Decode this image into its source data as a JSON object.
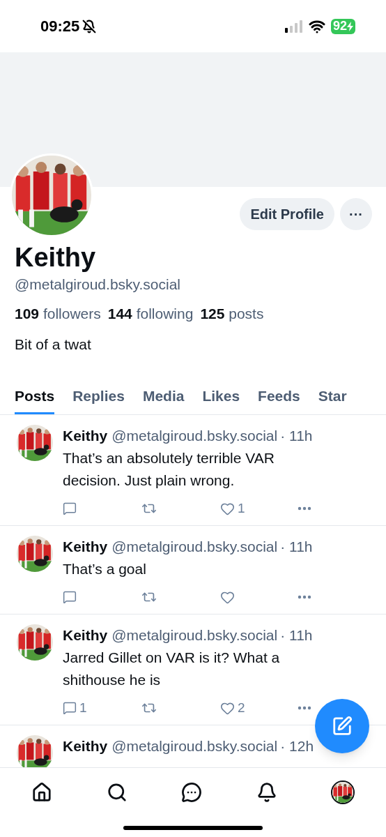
{
  "status_bar": {
    "time": "09:25",
    "battery": "92"
  },
  "profile": {
    "name": "Keithy",
    "handle": "@metalgiroud.bsky.social",
    "edit_button": "Edit Profile",
    "more_button": "···",
    "stats": [
      {
        "count": "109",
        "label": "followers"
      },
      {
        "count": "144",
        "label": "following"
      },
      {
        "count": "125",
        "label": "posts"
      }
    ],
    "bio": "Bit of a twat"
  },
  "tabs": [
    {
      "label": "Posts",
      "selected": true
    },
    {
      "label": "Replies",
      "selected": false
    },
    {
      "label": "Media",
      "selected": false
    },
    {
      "label": "Likes",
      "selected": false
    },
    {
      "label": "Feeds",
      "selected": false
    },
    {
      "label": "Star",
      "selected": false
    }
  ],
  "posts": [
    {
      "name": "Keithy",
      "handle": "@metalgiroud.bsky.social",
      "time": "· 11h",
      "text": "That’s an absolutely terrible VAR decision. Just plain wrong.",
      "likes": "1"
    },
    {
      "name": "Keithy",
      "handle": "@metalgiroud.bsky.social",
      "time": "· 11h",
      "text": "That’s a goal"
    },
    {
      "name": "Keithy",
      "handle": "@metalgiroud.bsky.social",
      "time": "· 11h",
      "text": "Jarred Gillet on VAR is it? What a shithouse he is",
      "replies": "1",
      "likes": "2"
    },
    {
      "name": "Keithy",
      "handle": "@metalgiroud.bsky.social",
      "time": "· 12h"
    }
  ],
  "nav": [
    {
      "kind": "home"
    },
    {
      "kind": "search"
    },
    {
      "kind": "chat"
    },
    {
      "kind": "bell"
    },
    {
      "kind": "avatar"
    }
  ]
}
